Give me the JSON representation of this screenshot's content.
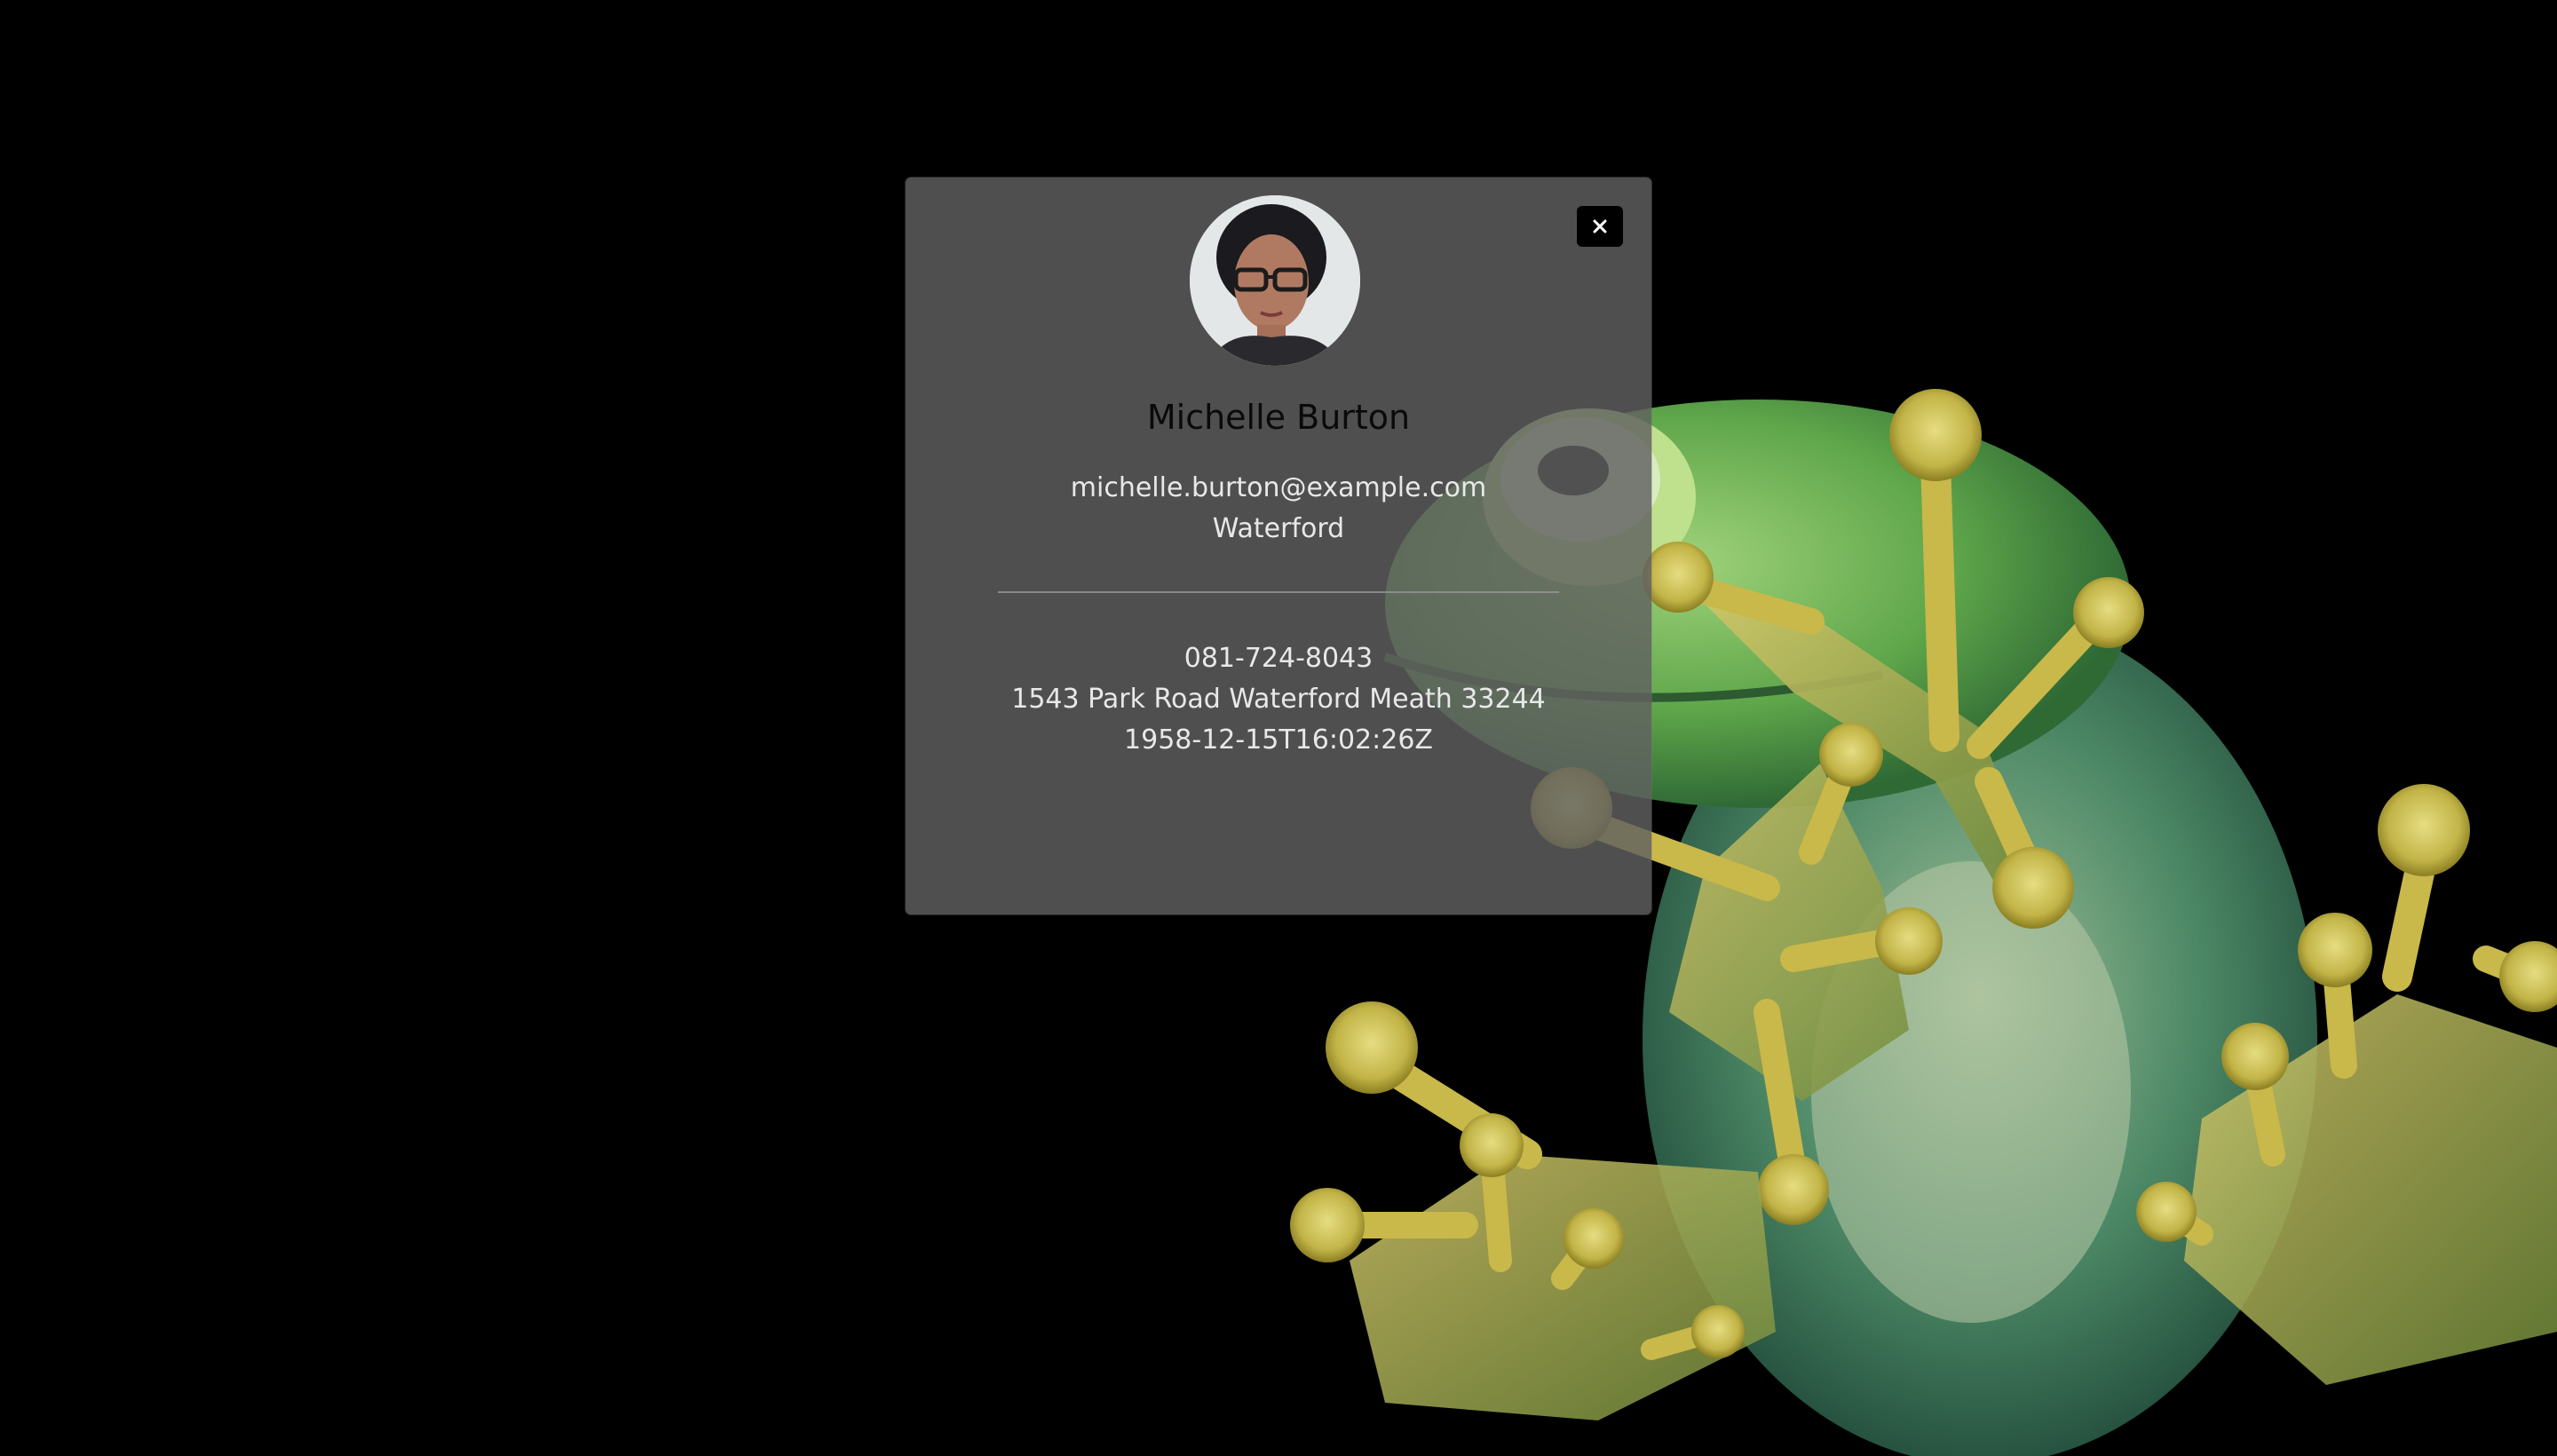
{
  "profile": {
    "name": "Michelle Burton",
    "email": "michelle.burton@example.com",
    "city": "Waterford",
    "phone": "081-724-8043",
    "address": "1543 Park Road Waterford Meath 33244",
    "dob": "1958-12-15T16:02:26Z"
  },
  "icons": {
    "close": "close-icon",
    "avatar": "avatar"
  },
  "colors": {
    "background": "#000000",
    "card": "#5f5f5f",
    "name_text": "#0a0a0a",
    "detail_text": "#e8e8e8",
    "close_button": "#000000",
    "frog_green": "#6aa84f",
    "frog_yellow": "#c9b84a"
  }
}
